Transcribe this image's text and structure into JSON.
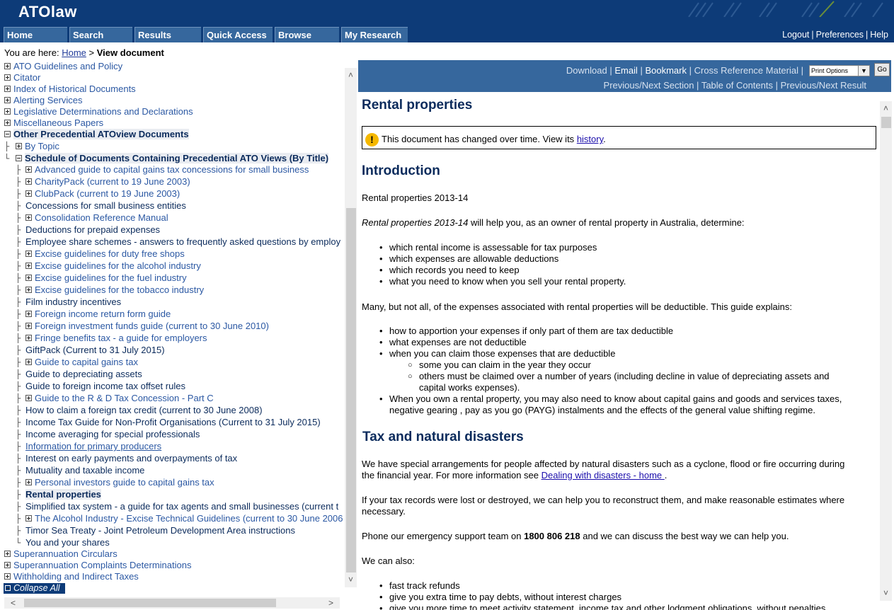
{
  "app": {
    "title": "ATOlaw"
  },
  "nav": {
    "tabs": [
      "Home",
      "Search",
      "Results",
      "Quick Access",
      "Browse",
      "My Research"
    ]
  },
  "util": {
    "logout": "Logout",
    "preferences": "Preferences",
    "help": "Help"
  },
  "breadcrumb": {
    "prefix": "You are here:",
    "home": "Home",
    "sep": ">",
    "current": "View document"
  },
  "tree": {
    "top_items": [
      "ATO Guidelines and Policy",
      "Citator",
      "Index of Historical Documents",
      "Alerting Services",
      "Legislative Determinations and Declarations",
      "Miscellaneous Papers"
    ],
    "expanded_parent": "Other Precedential ATOview Documents",
    "by_topic": "By Topic",
    "schedule": "Schedule of Documents Containing Precedential ATO Views (By Title)",
    "children": [
      "Advanced guide to capital gains tax concessions for small business",
      "CharityPack (current to 19 June 2003)",
      "ClubPack (current to 19 June 2003)",
      "Concessions for small business entities",
      "Consolidation Reference Manual",
      "Deductions for prepaid expenses",
      "Employee share schemes - answers to frequently asked questions by employ",
      "Excise guidelines for duty free shops",
      "Excise guidelines for the alcohol industry",
      "Excise guidelines for the fuel industry",
      "Excise guidelines for the tobacco industry",
      "Film industry incentives",
      "Foreign income return form guide",
      "Foreign investment funds guide (current to 30 June 2010)",
      "Fringe benefits tax - a guide for employers",
      "GiftPack (Current to 31 July 2015)",
      "Guide to capital gains tax",
      "Guide to depreciating assets",
      "Guide to foreign income tax offset rules",
      "Guide to the R & D Tax Concession - Part C",
      "How to claim a foreign tax credit (current to 30 June 2008)",
      "Income Tax Guide for Non-Profit Organisations (Current to 31 July 2015)",
      "Income averaging for special professionals",
      "Information for primary producers",
      "Interest on early payments and overpayments of tax",
      "Mutuality and taxable income",
      "Personal investors guide to capital gains tax",
      "Rental properties",
      "Simplified tax system - a guide for tax agents and small businesses (current t",
      "The Alcohol Industry - Excise Technical Guidelines (current to 30 June 2006",
      "Timor Sea Treaty - Joint Petroleum Development Area instructions",
      "You and your shares"
    ],
    "bottom_items": [
      "Superannuation Circulars",
      "Superannuation Complaints Determinations",
      "Withholding and Indirect Taxes"
    ],
    "collapse_all": "Collapse All"
  },
  "toolbar": {
    "download": "Download",
    "email": "Email",
    "bookmark": "Bookmark",
    "cross_ref": "Cross Reference Material",
    "print_options": "Print Options",
    "go": "Go",
    "prev_next_section": "Previous/Next Section",
    "toc": "Table of Contents",
    "prev_next_result": "Previous/Next Result"
  },
  "doc": {
    "title": "Rental properties",
    "notice_prefix": "This document has changed over time. View its",
    "notice_link": "history",
    "notice_suffix": ".",
    "intro_heading": "Introduction",
    "intro_p1": "Rental properties 2013-14",
    "intro_p2_em": "Rental properties 2013-14",
    "intro_p2_rest": " will help you, as an owner of rental property in Australia, determine:",
    "list1": [
      "which rental income is assessable for tax purposes",
      "which expenses are allowable deductions",
      "which records you need to keep",
      "what you need to know when you sell your rental property."
    ],
    "p3": "Many, but not all, of the expenses associated with rental properties will be deductible. This guide explains:",
    "list2": [
      "how to apportion your expenses if only part of them are tax deductible",
      "what expenses are not deductible",
      "when you can claim those expenses that are deductible"
    ],
    "list2_sub": [
      "some you can claim in the year they occur",
      "others must be claimed over a number of years (including decline in value of depreciating assets and capital works expenses)."
    ],
    "list2_last": "When you own a rental property, you may also need to know about capital gains and goods and services taxes, negative gearing , pay as you go (PAYG) instalments and the effects of the general value shifting regime.",
    "disaster_heading": "Tax and natural disasters",
    "disaster_p1": "We have special arrangements for people affected by natural disasters such as a cyclone, flood or fire occurring during the financial year. For more information see ",
    "disaster_link": "Dealing with disasters - home ",
    "disaster_p1_end": ".",
    "disaster_p2": "If your tax records were lost or destroyed, we can help you to reconstruct them, and make reasonable estimates where necessary.",
    "disaster_p3_a": "Phone our emergency support team on ",
    "disaster_phone": "1800 806 218",
    "disaster_p3_b": " and we can discuss the best way we can help you.",
    "disaster_p4": "We can also:",
    "list3": [
      "fast track refunds",
      "give you extra time to pay debts, without interest charges",
      "give you more time to meet activity statement, income tax and other lodgment obligations, without penalties"
    ]
  },
  "colors": {
    "header": "#0d3b78",
    "tab": "#36679d",
    "heading": "#0b2b5c",
    "link": "#2b58a3"
  }
}
